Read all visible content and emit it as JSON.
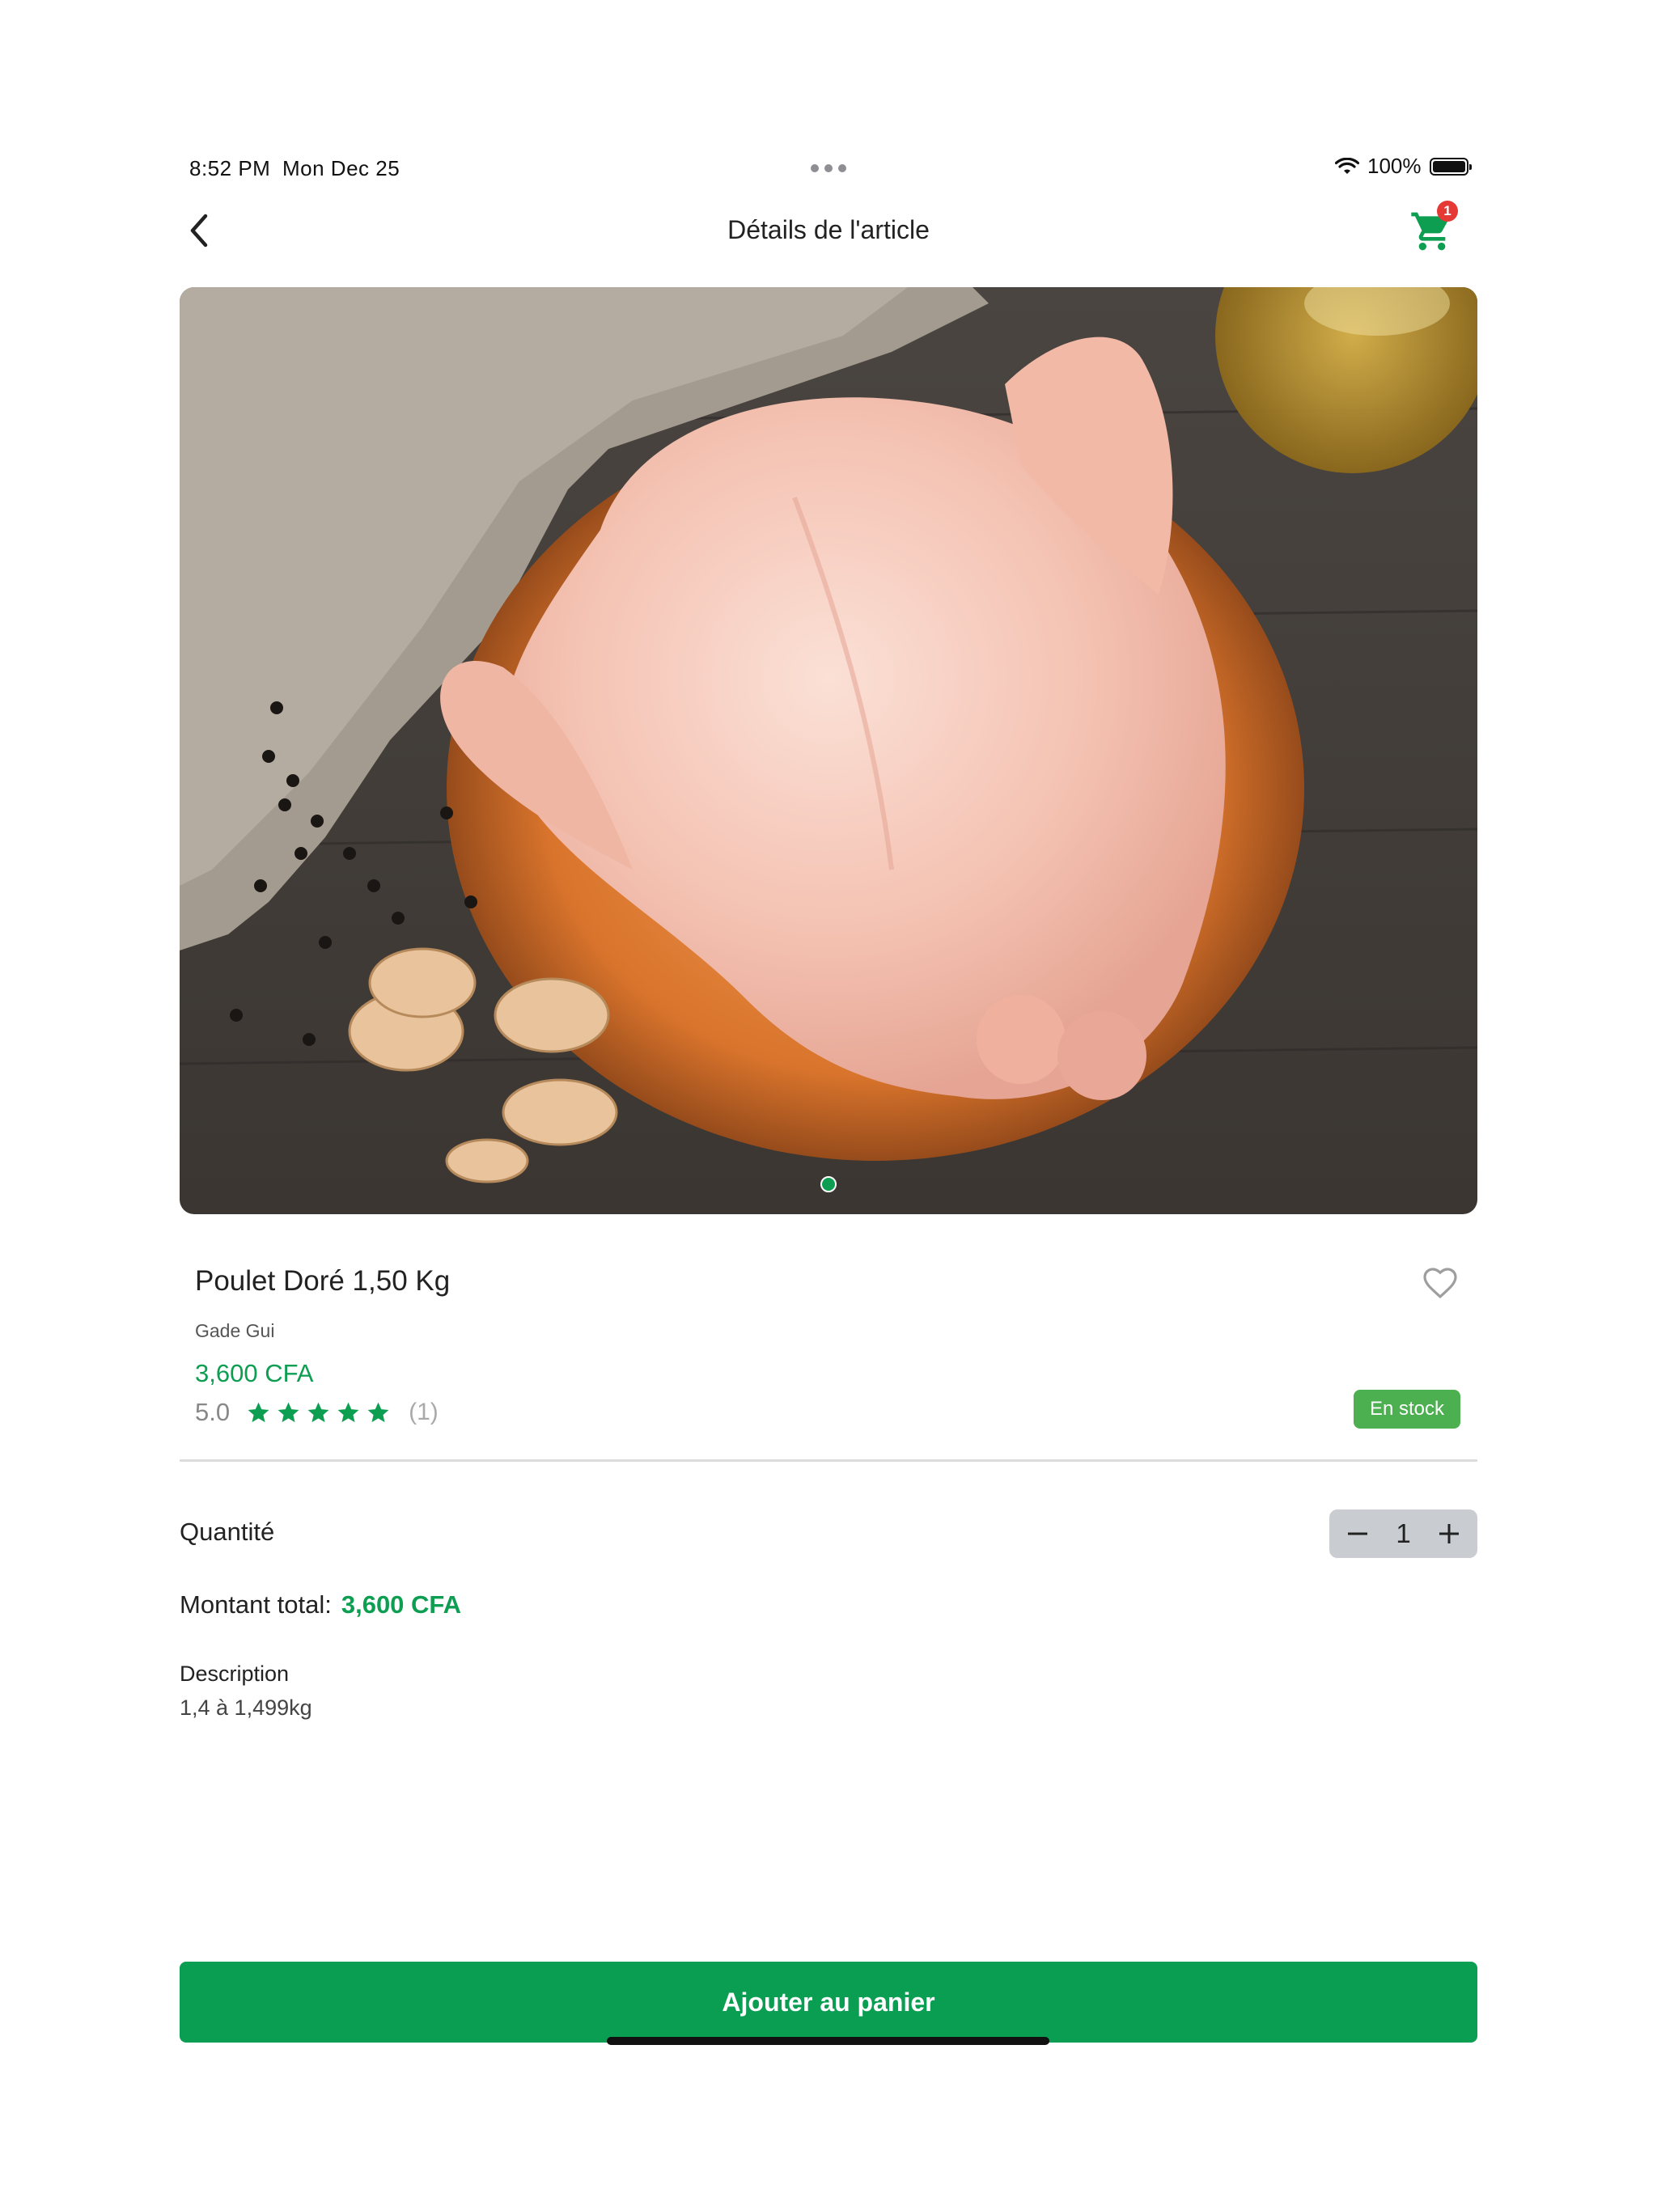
{
  "status_bar": {
    "time": "8:52 PM",
    "date": "Mon Dec 25",
    "battery": "100%",
    "icons": [
      "wifi-icon",
      "battery-icon"
    ]
  },
  "nav": {
    "title": "Détails de l'article",
    "back_icon": "chevron-left-icon",
    "cart_icon": "cart-icon",
    "cart_count": "1"
  },
  "product": {
    "image_alt": "Poulet Doré 1,50 Kg",
    "name": "Poulet Doré 1,50 Kg",
    "brand": "Gade Gui",
    "price": "3,600 CFA",
    "rating": "5.0",
    "stars": 5,
    "rating_count": "(1)",
    "stock": "En stock",
    "favorite_icon": "heart-outline-icon"
  },
  "quantity": {
    "label": "Quantité",
    "value": "1"
  },
  "total": {
    "label": "Montant total:",
    "value": "3,600 CFA"
  },
  "description": {
    "title": "Description",
    "text": "1,4 à 1,499kg"
  },
  "actions": {
    "add_to_cart": "Ajouter au panier"
  },
  "colors": {
    "accent": "#0d9e52",
    "badge_red": "#e53935",
    "stock_green": "#4caf50"
  }
}
